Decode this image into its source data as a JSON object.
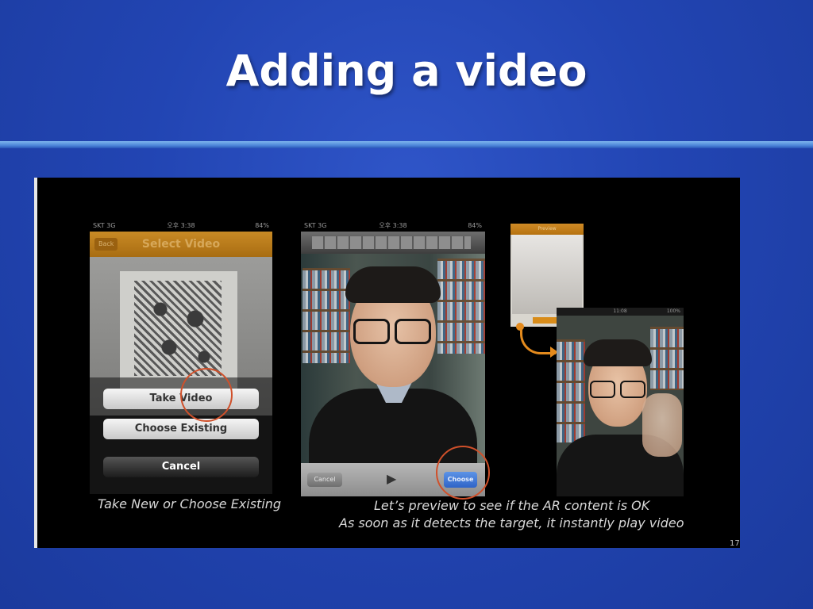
{
  "slide": {
    "title": "Adding a video",
    "page_number": "17"
  },
  "phone1": {
    "status": {
      "left": "SKT 3G",
      "time": "오후 3:38",
      "right": "84%"
    },
    "nav_back": "Back",
    "nav_title": "Select Video",
    "buttons": {
      "take_video": "Take Video",
      "choose_existing": "Choose Existing",
      "cancel": "Cancel"
    }
  },
  "phone2": {
    "status": {
      "left": "SKT 3G",
      "time": "오후 3:38",
      "right": "84%"
    },
    "cancel": "Cancel",
    "play_icon": "▶",
    "choose": "Choose"
  },
  "phone3": {
    "nav_title": "Preview",
    "ok": "OK"
  },
  "phone4": {
    "status": {
      "time": "11:08",
      "right": "100%"
    }
  },
  "captions": {
    "left": "Take New or Choose Existing",
    "right_line1": "Let’s preview to see if the AR content is OK",
    "right_line2": "As soon as it detects the target, it instantly play video"
  },
  "colors": {
    "background": "#2245b3",
    "accent_orange": "#e38a1d",
    "highlight_circle": "#d0502a"
  }
}
